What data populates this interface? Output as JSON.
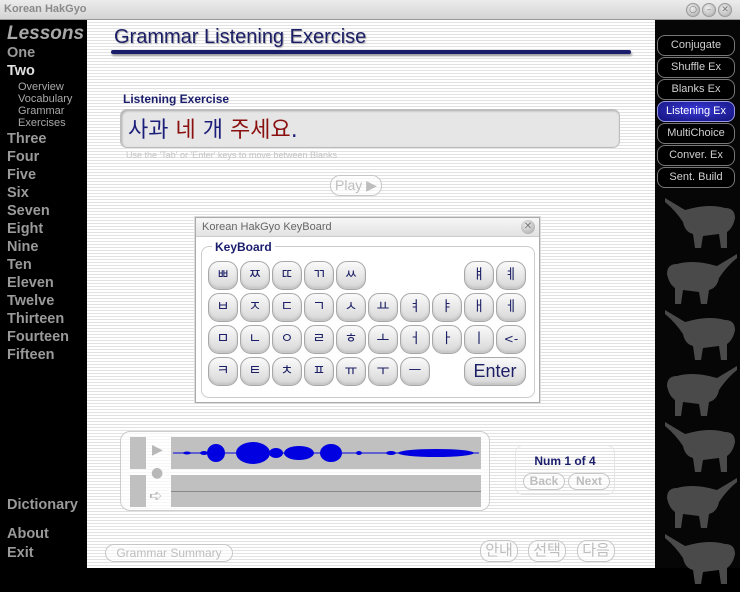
{
  "window": {
    "title": "Korean HakGyo"
  },
  "sidebar": {
    "header": "Lessons",
    "lessons": [
      "One",
      "Two",
      "Three",
      "Four",
      "Five",
      "Six",
      "Seven",
      "Eight",
      "Nine",
      "Ten",
      "Eleven",
      "Twelve",
      "Thirteen",
      "Fourteen",
      "Fifteen"
    ],
    "active_lesson": "Two",
    "sub_items": [
      "Overview",
      "Vocabulary",
      "Grammar",
      "Exercises"
    ],
    "dictionary": "Dictionary",
    "about": "About",
    "exit": "Exit"
  },
  "main": {
    "title": "Grammar Listening Exercise",
    "section_label": "Listening Exercise",
    "answer_words": [
      {
        "text": "사과",
        "color": "#1c1f7a"
      },
      {
        "text": "네",
        "color": "#8a1010"
      },
      {
        "text": "개",
        "color": "#1c1f7a"
      },
      {
        "text": "주세요",
        "color": "#8a1010"
      },
      {
        "text": ".",
        "color": "#1c1f7a"
      }
    ],
    "hint": "Use the 'Tab' or 'Enter' keys to move between Blanks",
    "play_label": "Play ▶"
  },
  "keyboard": {
    "window_title": "Korean HakGyo KeyBoard",
    "group_label": "KeyBoard",
    "row1_left": [
      "ㅃ",
      "ㅉ",
      "ㄸ",
      "ㄲ",
      "ㅆ"
    ],
    "row1_right": [
      "ㅒ",
      "ㅖ"
    ],
    "row2": [
      "ㅂ",
      "ㅈ",
      "ㄷ",
      "ㄱ",
      "ㅅ",
      "ㅛ",
      "ㅕ",
      "ㅑ",
      "ㅐ",
      "ㅔ"
    ],
    "row3": [
      "ㅁ",
      "ㄴ",
      "ㅇ",
      "ㄹ",
      "ㅎ",
      "ㅗ",
      "ㅓ",
      "ㅏ",
      "ㅣ",
      "<-"
    ],
    "row4": [
      "ㅋ",
      "ㅌ",
      "ㅊ",
      "ㅍ",
      "ㅠ",
      "ㅜ",
      "ㅡ"
    ],
    "enter": "Enter"
  },
  "audio": {
    "play_icon": "▶",
    "record_icon": "●",
    "playback_icon": "➪"
  },
  "navigation": {
    "counter": "Num 1 of 4",
    "back": "Back",
    "next": "Next"
  },
  "footer": {
    "grammar_summary": "Grammar Summary",
    "guide": "안내",
    "select": "선택",
    "next": "다음"
  },
  "exercise_menu": {
    "items": [
      "Conjugate",
      "Shuffle Ex",
      "Blanks Ex",
      "Listening Ex",
      "MultiChoice",
      "Conver. Ex",
      "Sent. Build"
    ],
    "active": "Listening Ex"
  },
  "colors": {
    "accent": "#1a1d6b",
    "active_tab": "#2a2ac0",
    "highlight_red": "#8a1010"
  }
}
